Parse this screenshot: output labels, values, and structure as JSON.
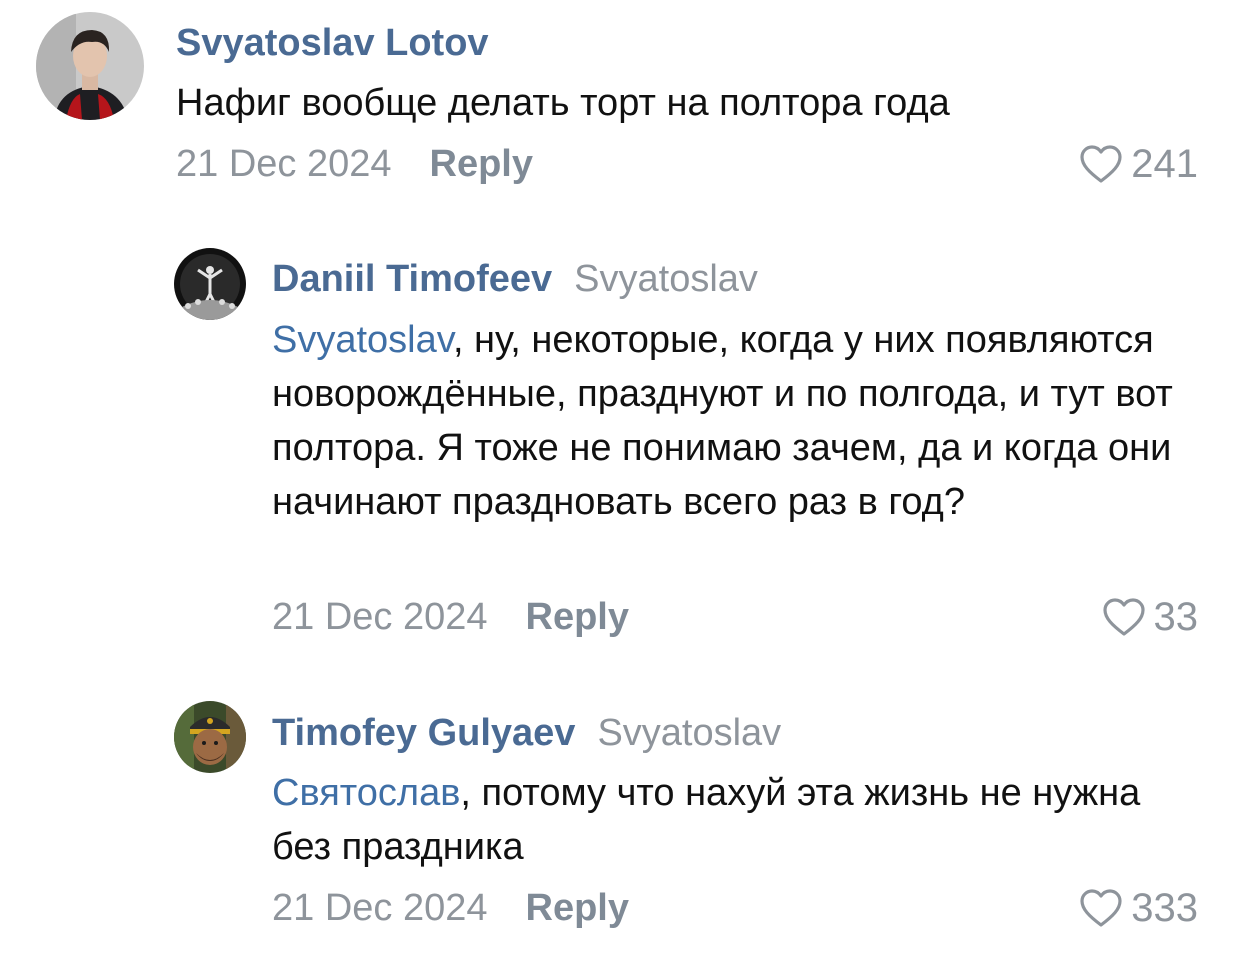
{
  "comments": [
    {
      "author": "Svyatoslav Lotov",
      "reply_to": "",
      "mention": "",
      "text": "Нафиг вообще делать торт на полтора года",
      "date": "21 Dec 2024",
      "reply_label": "Reply",
      "likes": "241"
    },
    {
      "author": "Daniil Timofeev",
      "reply_to": "Svyatoslav",
      "mention": "Svyatoslav",
      "text": ", ну, некоторые, когда у них появляются новорождённые, празднуют и по полгода, и тут вот полтора. Я тоже не понимаю зачем, да и когда они начинают праздновать всего раз в год?",
      "date": "21 Dec 2024",
      "reply_label": "Reply",
      "likes": "33"
    },
    {
      "author": "Timofey Gulyaev",
      "reply_to": "Svyatoslav",
      "mention": "Святослав",
      "text": ", потому что нахуй эта жизнь не нужна без праздника",
      "date": "21 Dec 2024",
      "reply_label": "Reply",
      "likes": "333"
    }
  ],
  "icons": {
    "like": "heart-outline-icon"
  },
  "colors": {
    "author": "#4a6a93",
    "mention": "#3f6fa6",
    "meta": "#8e949b"
  }
}
